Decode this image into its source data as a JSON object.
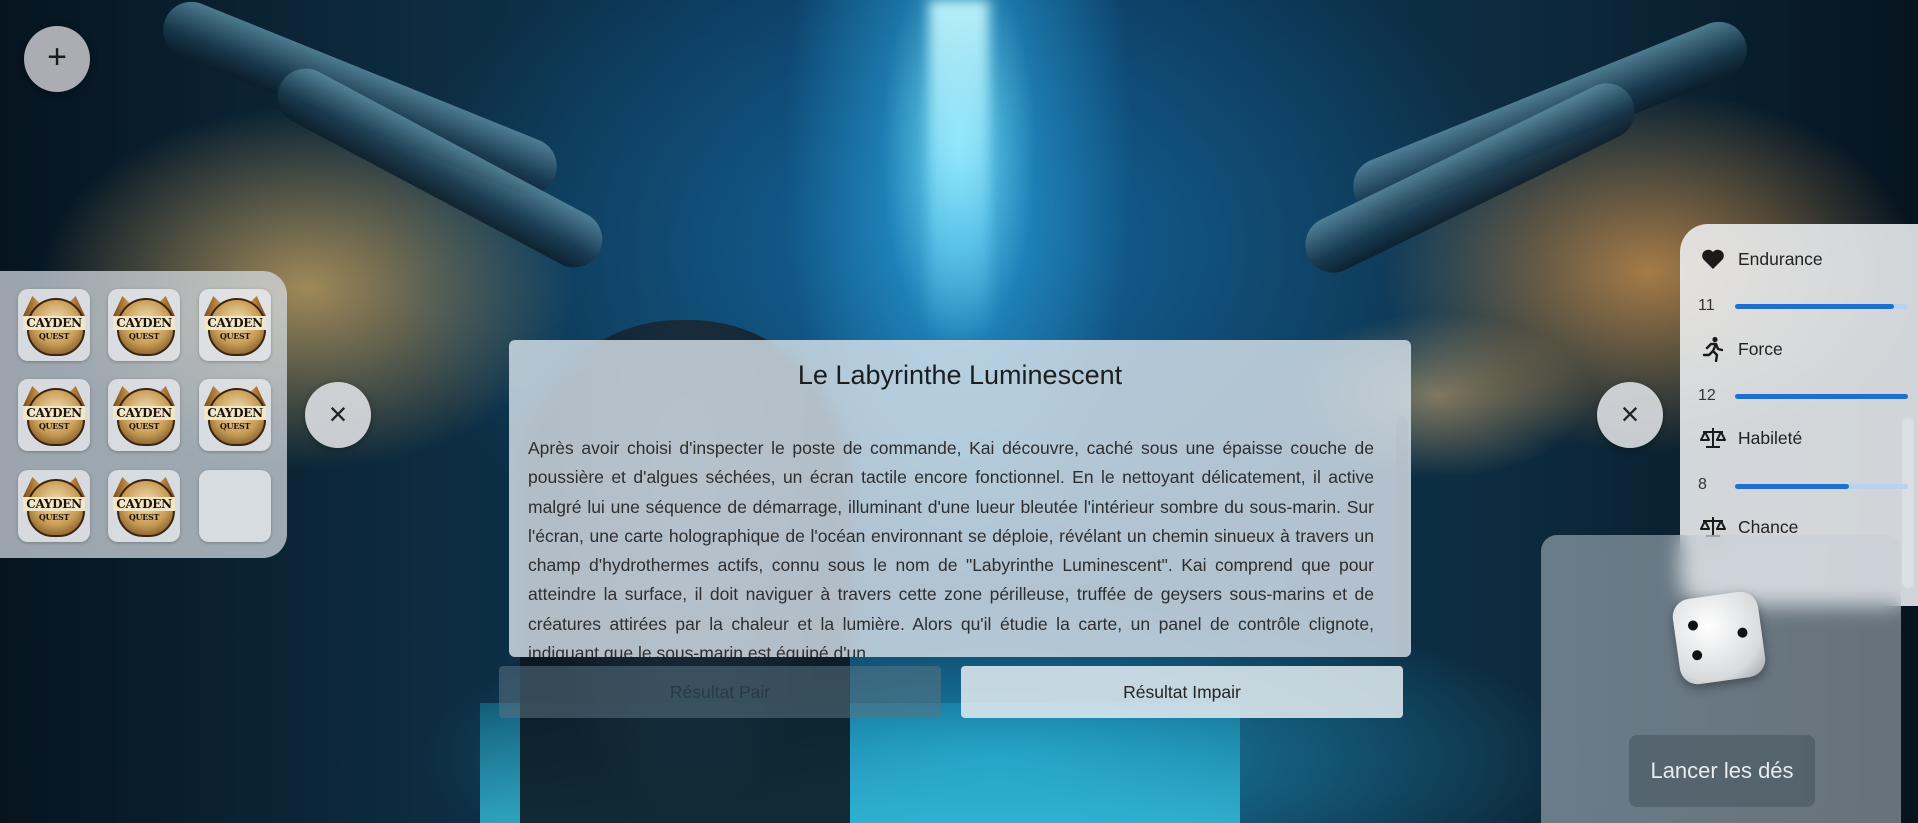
{
  "header": {
    "add_button_label": "+"
  },
  "inventory": {
    "items": [
      {
        "line1": "CAYDEN",
        "line2": "QUEST"
      },
      {
        "line1": "CAYDEN",
        "line2": "QUEST"
      },
      {
        "line1": "CAYDEN",
        "line2": "QUEST"
      },
      {
        "line1": "CAYDEN",
        "line2": "QUEST"
      },
      {
        "line1": "CAYDEN",
        "line2": "QUEST"
      },
      {
        "line1": "CAYDEN",
        "line2": "QUEST"
      },
      {
        "line1": "CAYDEN",
        "line2": "QUEST"
      },
      {
        "line1": "CAYDEN",
        "line2": "QUEST"
      }
    ],
    "close_label": "×"
  },
  "story": {
    "title": "Le Labyrinthe Luminescent",
    "text": "Après avoir choisi d'inspecter le poste de commande, Kai découvre, caché sous une épaisse couche de poussière et d'algues séchées, un écran tactile encore fonctionnel. En le nettoyant délicatement, il active malgré lui une séquence de démarrage, illuminant d'une lueur bleutée l'intérieur sombre du sous-marin. Sur l'écran, une carte holographique de l'océan environnant se déploie, révélant un chemin sinueux à travers un champ d'hydrothermes actifs, connu sous le nom de \"Labyrinthe Luminescent\". Kai comprend que pour atteindre la surface, il doit naviguer à travers cette zone périlleuse, truffée de geysers sous-marins et de créatures attirées par la chaleur et la lumière. Alors qu'il étudie la carte, un panel de contrôle clignote, indiquant que le sous-marin est équipé d'un"
  },
  "choices": {
    "even": "Résultat Pair",
    "odd": "Résultat Impair"
  },
  "stats": {
    "close_label": "×",
    "items": [
      {
        "label": "Endurance",
        "icon": "heart-icon",
        "value": "11",
        "level": 0.92
      },
      {
        "label": "Force",
        "icon": "running-icon",
        "value": "12",
        "level": 1.0
      },
      {
        "label": "Habileté",
        "icon": "balance-icon",
        "value": "8",
        "level": 0.66
      },
      {
        "label": "Chance",
        "icon": "balance-icon",
        "value": null,
        "level": null
      }
    ],
    "accent": "#1f6fd0"
  },
  "dice": {
    "roll_label": "Lancer les dés"
  }
}
